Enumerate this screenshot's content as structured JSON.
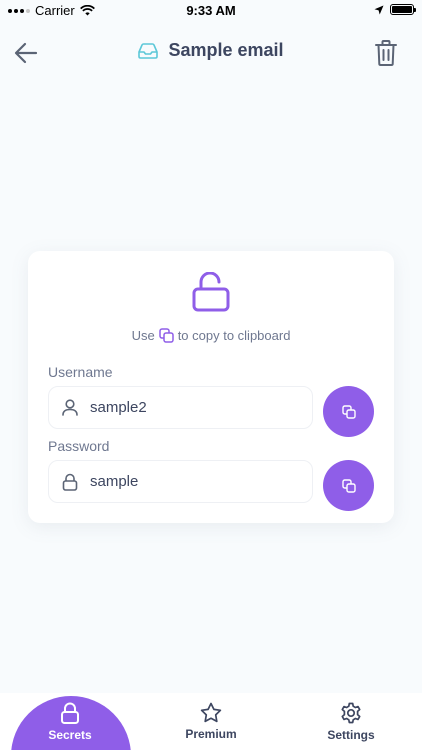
{
  "status": {
    "carrier": "Carrier",
    "time": "9:33 AM"
  },
  "header": {
    "title": "Sample email",
    "back_icon": "arrow-left-icon",
    "title_icon": "inbox-icon",
    "delete_icon": "trash-icon"
  },
  "card": {
    "hint_prefix": "Use",
    "hint_suffix": "to copy to clipboard",
    "username_label": "Username",
    "username_value": "sample2",
    "password_label": "Password",
    "password_value": "sample"
  },
  "tabbar": {
    "tabs": [
      {
        "label": "Secrets",
        "icon": "lock-icon",
        "active": true
      },
      {
        "label": "Premium",
        "icon": "star-icon",
        "active": false
      },
      {
        "label": "Settings",
        "icon": "gear-icon",
        "active": false
      }
    ]
  },
  "colors": {
    "accent": "#8f5ee8",
    "text": "#3d4660",
    "muted": "#6f7890",
    "background": "#f8fbfd",
    "title_icon": "#5cc8d8"
  }
}
